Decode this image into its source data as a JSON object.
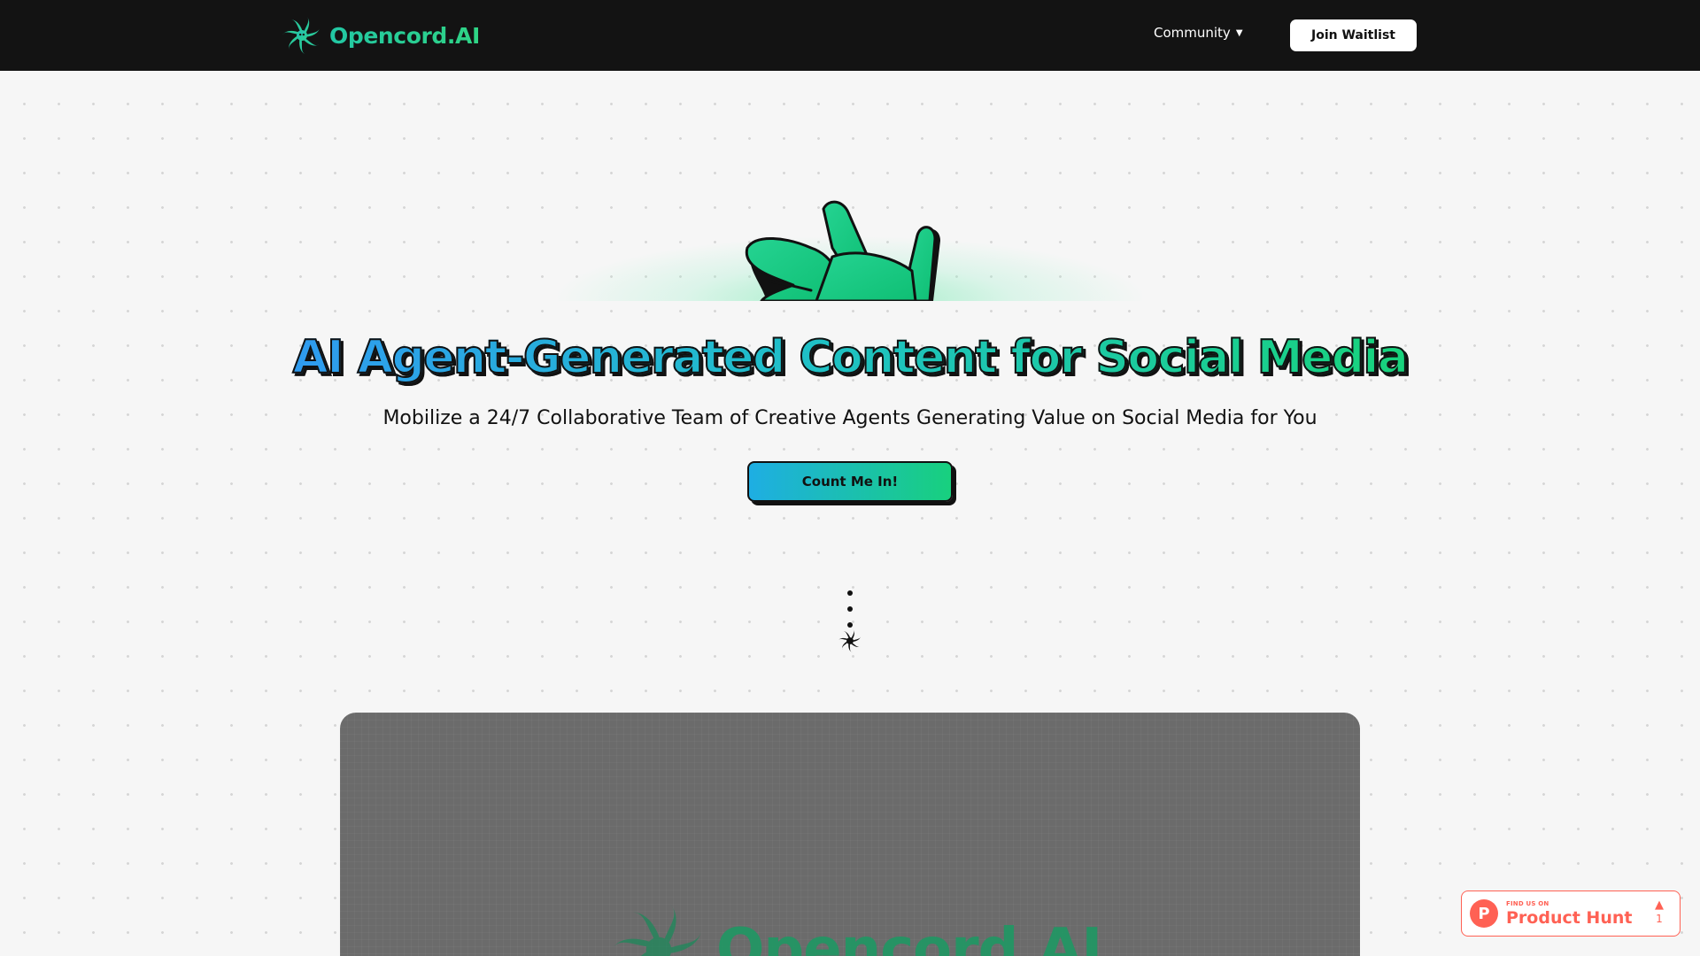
{
  "colors": {
    "nav_bg": "#131313",
    "brand_green": "#2fd485",
    "title_gradient_start": "#2f9bf0",
    "title_gradient_end": "#18d37c",
    "cta_gradient_start": "#1eaee3",
    "cta_gradient_end": "#18d07e",
    "preview_bg": "#6b6b6b",
    "product_hunt": "#ff6154"
  },
  "nav": {
    "brand_name": "Opencord.AI",
    "brand_icon": "opencord-swirl-icon",
    "community_label": "Community",
    "community_caret": "▼",
    "join_label": "Join Waitlist"
  },
  "hero": {
    "mascot_icon": "opencord-mascot-icon",
    "title": "AI Agent-Generated Content for Social Media",
    "subtitle": "Mobilize a 24/7 Collaborative Team of Creative Agents Generating Value on Social Media for You",
    "cta_label": "Count Me In!",
    "scroll_indicator_icon": "scroll-down-swirl-icon"
  },
  "preview": {
    "brand_name": "Opencord.AI",
    "brand_icon": "opencord-swirl-icon"
  },
  "product_hunt": {
    "small_label": "FIND US ON",
    "big_label": "Product Hunt",
    "logo_letter": "P",
    "arrow": "▲",
    "upvotes": "1"
  }
}
